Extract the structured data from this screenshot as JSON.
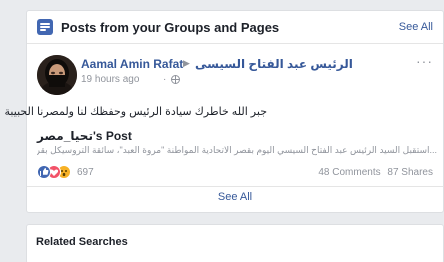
{
  "posts_card": {
    "title": "Posts from your Groups and Pages",
    "see_all_header": "See All",
    "icon": "news-feed-icon",
    "post": {
      "author": "Aamal Amin Rafat",
      "group": "الرئيس عبد الفتاح السيسى",
      "time": "19 hours ago",
      "time_separator": "·",
      "privacy_icon": "globe-icon",
      "more_label": "···",
      "text": "جبر الله خاطرك سيادة الرئيس وحفظك لنا ولمصرنا الحبيبة",
      "shared_title": "تحيا_مصر's Post",
      "shared_desc": "...استقبل السيد الرئيس عبد الفتاح السيسي اليوم بقصر الاتحادية المواطنة \"مروة العبد\"، سائقة التروسيكل بقرية الحيرات",
      "reactions": [
        "like-icon",
        "love-icon",
        "wow-icon"
      ],
      "reaction_count": "697",
      "comments": "48 Comments",
      "shares": "87 Shares"
    },
    "see_all_footer": "See All"
  },
  "related_card": {
    "title": "Related Searches"
  },
  "colors": {
    "link": "#365899",
    "brand": "#4267b2",
    "muted": "#90949c",
    "background": "#e9ebee"
  }
}
